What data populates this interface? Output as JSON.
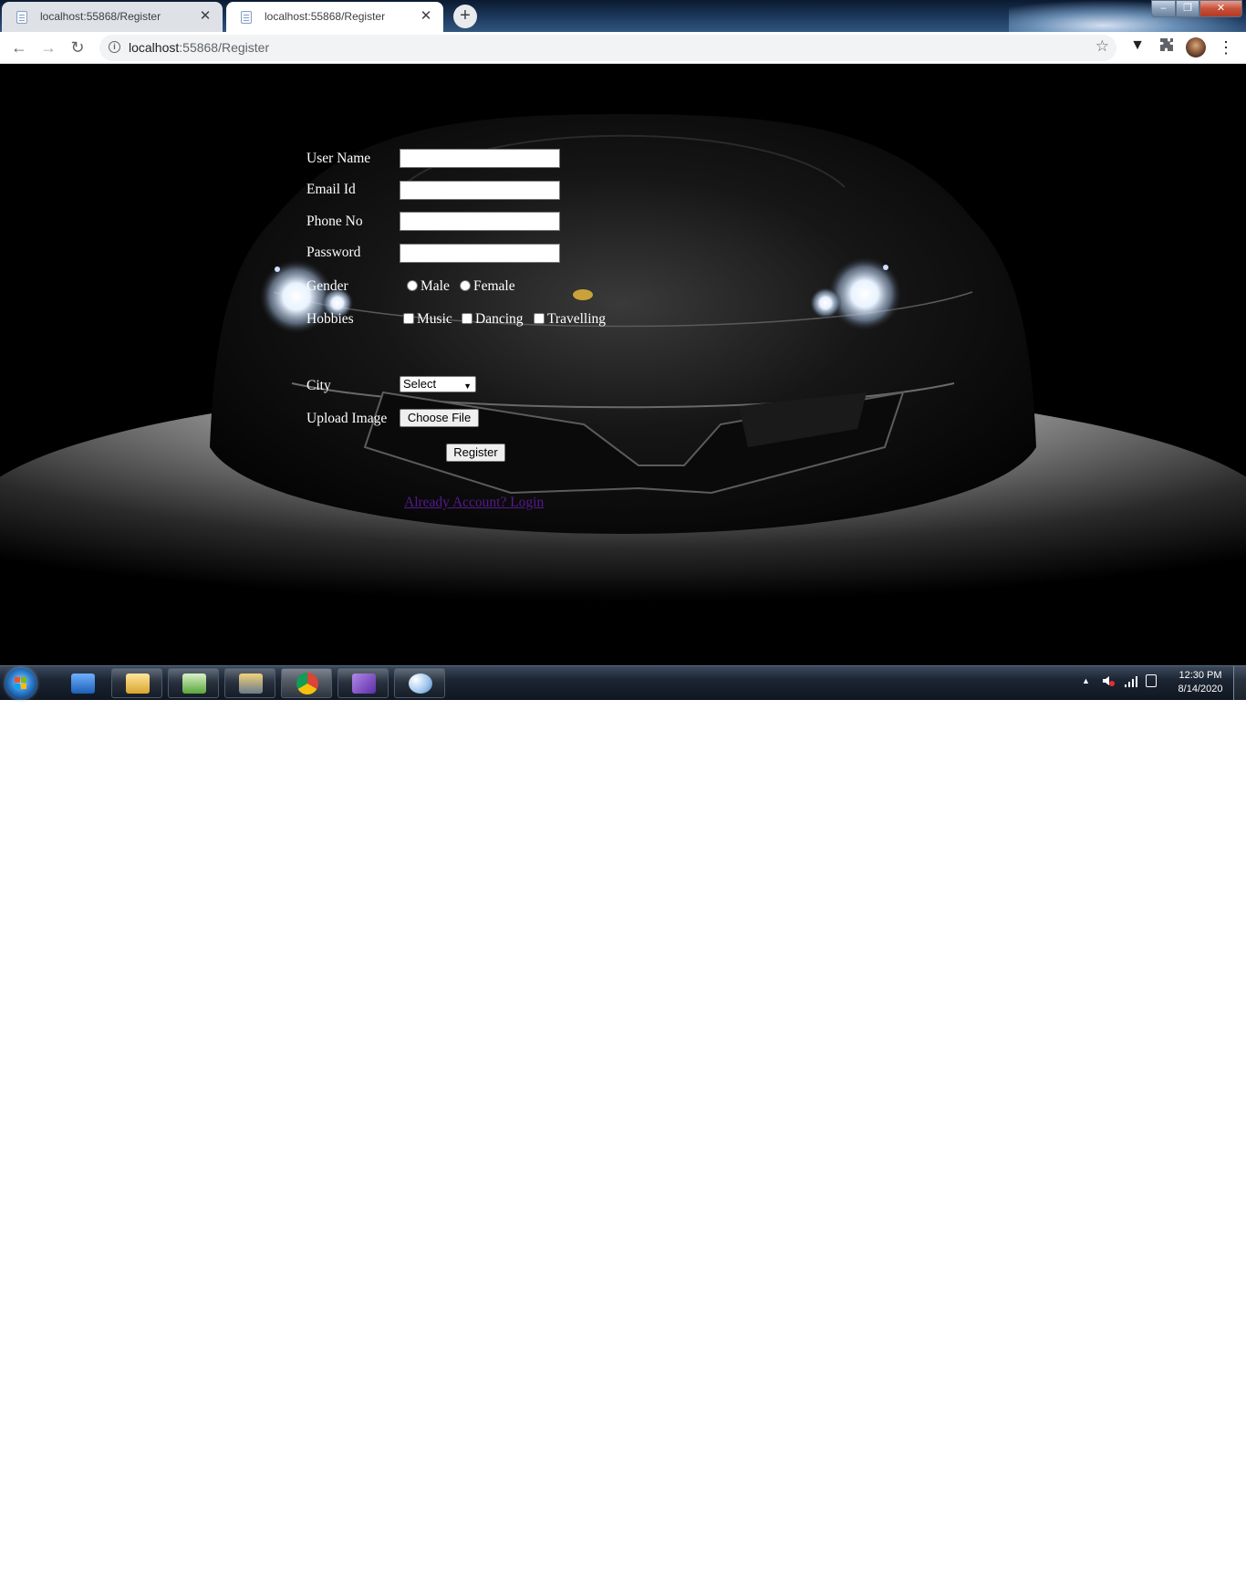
{
  "browser": {
    "tabs": [
      {
        "title": "localhost:55868/Register",
        "close": "✕"
      },
      {
        "title": "localhost:55868/Register",
        "close": "✕"
      }
    ],
    "new_tab": "+",
    "url_host": "localhost",
    "url_path": ":55868/Register",
    "window_buttons": {
      "minimize": "–",
      "maximize": "❐",
      "close": "✕"
    }
  },
  "form": {
    "username_label": "User Name",
    "email_label": "Email Id",
    "phone_label": "Phone No",
    "password_label": "Password",
    "gender_label": "Gender",
    "gender_options": [
      "Male",
      "Female"
    ],
    "hobbies_label": "Hobbies",
    "hobby_options": [
      "Music",
      "Dancing",
      "Travelling"
    ],
    "city_label": "City",
    "city_selected": "Select",
    "upload_label": "Upload Image",
    "choose_file": "Choose File",
    "register": "Register",
    "login_link": "Already Account? Login",
    "username_value": "",
    "email_value": "",
    "phone_value": "",
    "password_value": ""
  },
  "taskbar": {
    "time": "12:30 PM",
    "date": "8/14/2020",
    "tray_arrow": "▲"
  },
  "colors": {
    "link": "#551a8b",
    "page_background": "#000000"
  }
}
